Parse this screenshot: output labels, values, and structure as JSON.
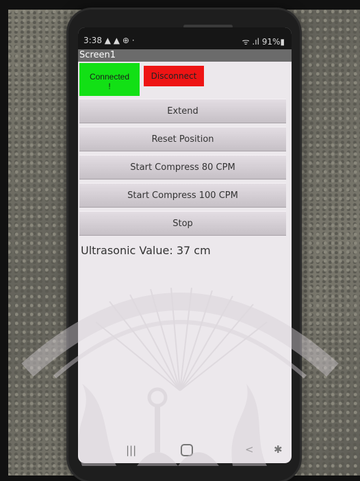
{
  "status": {
    "time": "3:38 ▲ ▲ ⊕ ·",
    "right": "ᯤ .ıl 91%▮"
  },
  "app": {
    "title": "Screen1"
  },
  "connection": {
    "connected_label": "Connected\n!",
    "disconnect_label": "Disconnect"
  },
  "actions": [
    {
      "label": "Extend"
    },
    {
      "label": "Reset Position"
    },
    {
      "label": "Start Compress 80 CPM"
    },
    {
      "label": "Start Compress 100 CPM"
    },
    {
      "label": "Stop"
    }
  ],
  "sensor": {
    "ultrasonic_text": "Ultrasonic Value: 37 cm"
  },
  "nav": {
    "recent": "|||",
    "back": "<",
    "accessibility": "✱"
  },
  "colors": {
    "connected": "#12e015",
    "disconnect": "#ee1414",
    "titlebar": "#6b6b6b"
  }
}
